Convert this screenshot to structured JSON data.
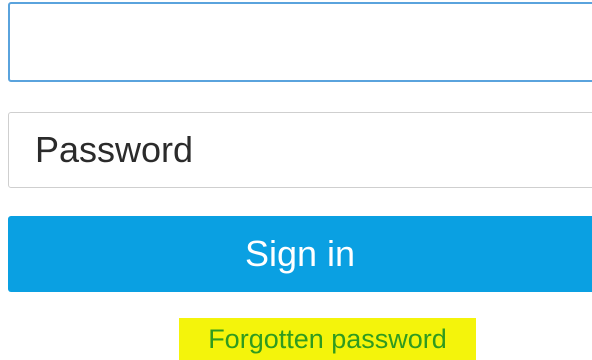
{
  "login": {
    "username": {
      "value": "",
      "placeholder": ""
    },
    "password": {
      "value": "",
      "placeholder": "Password"
    },
    "signin_label": "Sign in",
    "forgot_label": "Forgotten password"
  },
  "colors": {
    "primary_button": "#0aa0e2",
    "focus_border": "#5aa3dd",
    "link": "#2f9b1f",
    "highlight": "#f4f40b"
  }
}
